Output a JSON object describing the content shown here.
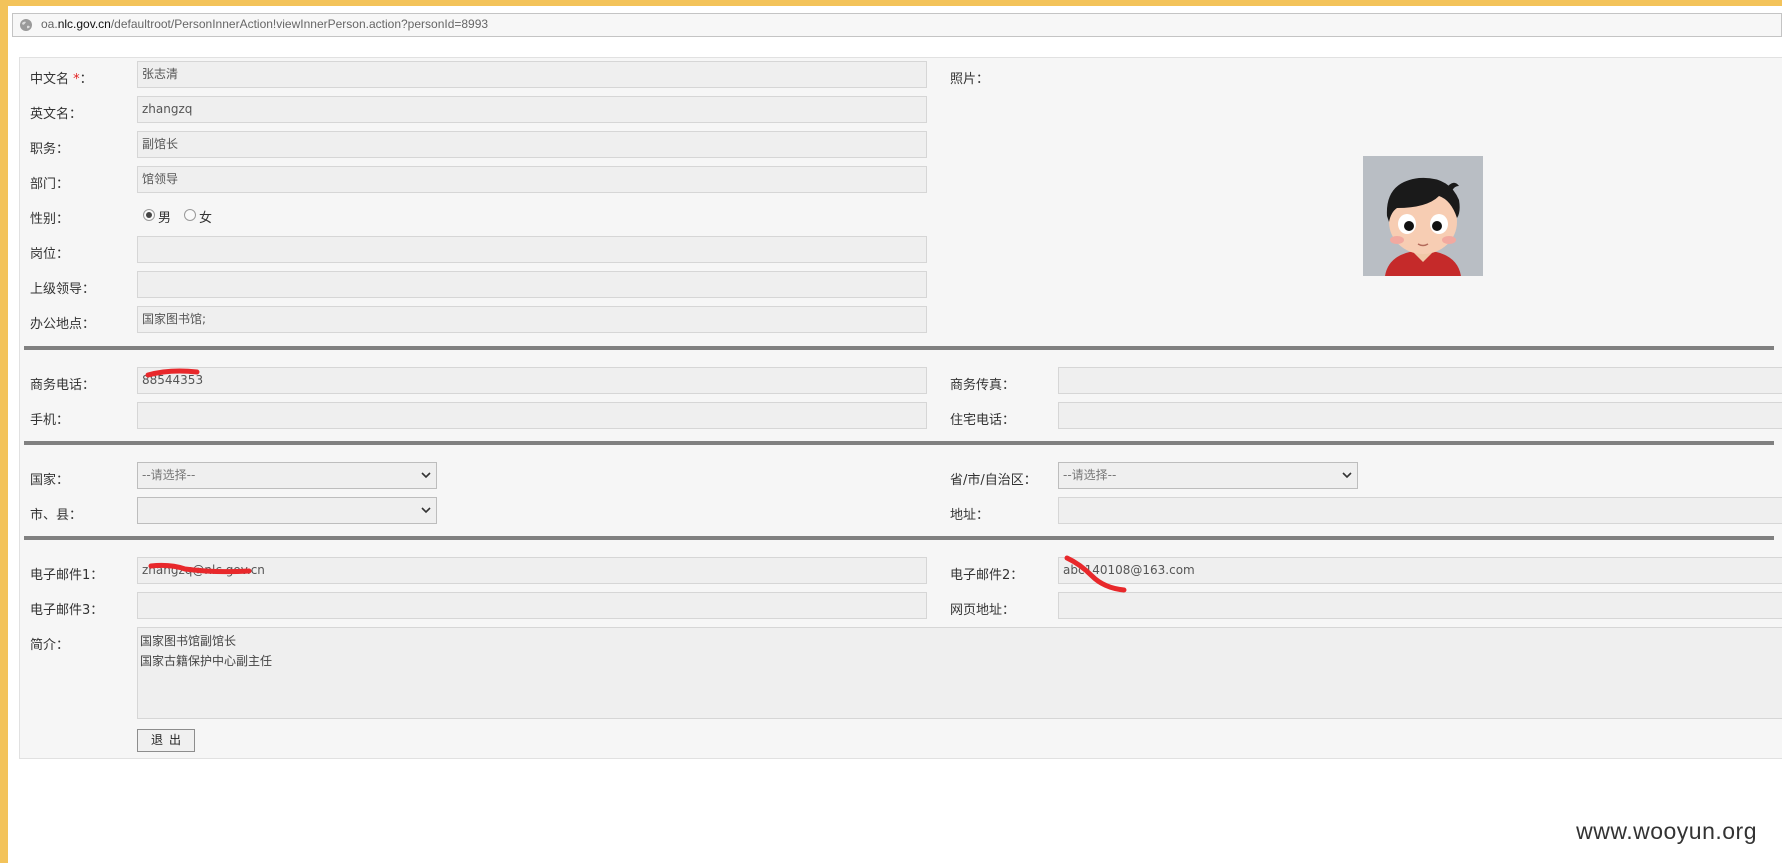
{
  "browser": {
    "url_prefix": "oa.",
    "url_domain": "nlc.gov.cn",
    "url_path": "/defaultroot/PersonInnerAction!viewInnerPerson.action?personId=8993"
  },
  "basic": {
    "chinese_name_label": "中文名",
    "required_mark": "*",
    "label_colon": "：",
    "chinese_name_value": "张志清",
    "english_name_label": "英文名：",
    "english_name_value": "zhangzq",
    "title_label": "职务：",
    "title_value": "副馆长",
    "department_label": "部门：",
    "department_value": "馆领导",
    "gender_label": "性别：",
    "gender_male": "男",
    "gender_female": "女",
    "gender_selected": "男",
    "post_label": "岗位：",
    "post_value": "",
    "superior_label": "上级领导：",
    "superior_value": "",
    "office_label": "办公地点：",
    "office_value": "国家图书馆;",
    "photo_label": "照片："
  },
  "phones": {
    "business_phone_label": "商务电话：",
    "business_phone_value": "88544353",
    "business_fax_label": "商务传真：",
    "business_fax_value": "",
    "mobile_label": "手机：",
    "mobile_value": "",
    "home_phone_label": "住宅电话：",
    "home_phone_value": ""
  },
  "location": {
    "country_label": "国家：",
    "country_value": "--请选择--",
    "province_label": "省/市/自治区：",
    "province_value": "--请选择--",
    "city_label": "市、县：",
    "city_value": "",
    "address_label": "地址：",
    "address_value": ""
  },
  "contact": {
    "email1_label": "电子邮件1：",
    "email1_value": "zhangzq@nlc.gov.cn",
    "email2_label": "电子邮件2：",
    "email2_value": "abc140108@163.com",
    "email3_label": "电子邮件3：",
    "email3_value": "",
    "web_label": "网页地址：",
    "web_value": "",
    "intro_label": "简介：",
    "intro_line1": "国家图书馆副馆长",
    "intro_line2": "国家古籍保护中心副主任"
  },
  "actions": {
    "exit_label": "退出"
  },
  "watermark": "www.wooyun.org",
  "colors": {
    "window_frame": "#f3c35a",
    "panel_bg": "#f6f6f6",
    "field_bg": "#efefef",
    "divider": "#808080",
    "required": "#e21d1d",
    "redaction": "#e8282b"
  },
  "icons": {
    "url": "globe-icon",
    "select": "chevron-down-icon",
    "photo": "cartoon-avatar"
  }
}
